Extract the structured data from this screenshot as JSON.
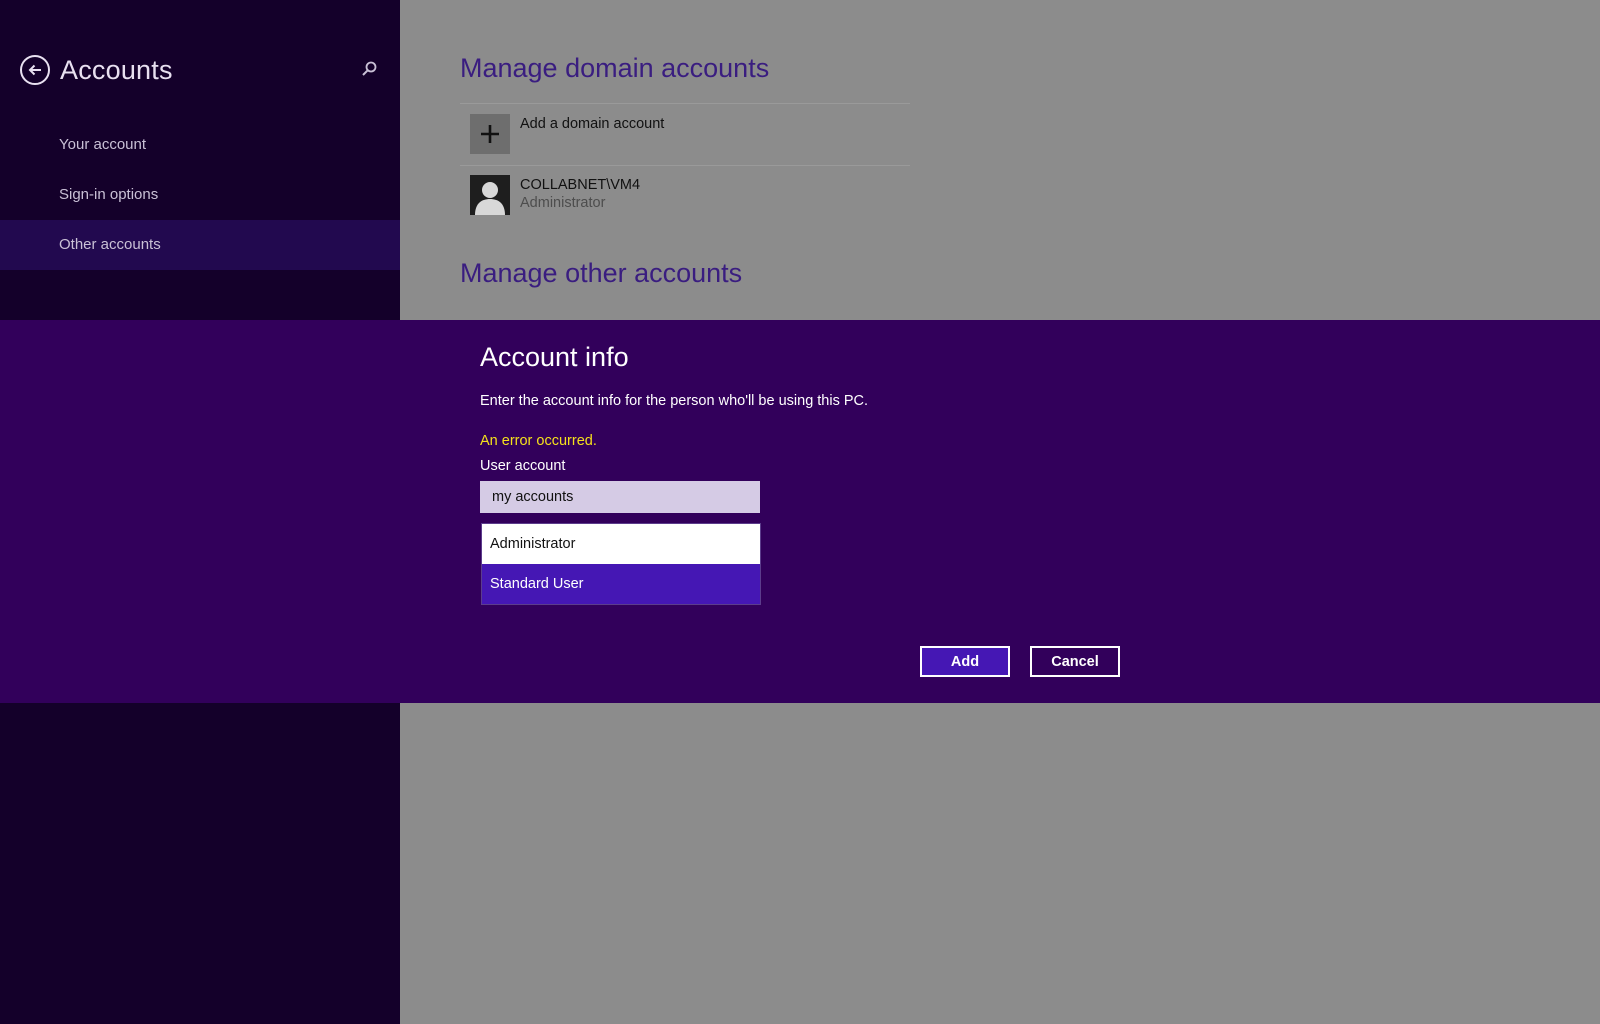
{
  "sidebar": {
    "title": "Accounts",
    "back_icon": "back-arrow-icon",
    "search_icon": "search-icon",
    "items": [
      {
        "label": "Your account"
      },
      {
        "label": "Sign-in options"
      },
      {
        "label": "Other accounts",
        "selected": true
      }
    ]
  },
  "main": {
    "domain_section_title": "Manage domain accounts",
    "add_domain": {
      "label": "Add a domain account",
      "icon": "plus-icon"
    },
    "domain_account": {
      "name": "COLLABNET\\VM4",
      "role": "Administrator",
      "icon": "user-icon"
    },
    "other_section_title": "Manage other accounts"
  },
  "dialog": {
    "title": "Account info",
    "description": "Enter the account info for the person who'll be using this PC.",
    "error": "An error occurred.",
    "user_account_label": "User account",
    "user_account_value": "my accounts",
    "account_type_options": [
      "Administrator",
      "Standard User"
    ],
    "highlighted_option": "Standard User",
    "add_label": "Add",
    "cancel_label": "Cancel"
  },
  "colors": {
    "sidebar_bg": "#14002a",
    "dialog_bg": "#32005b",
    "accent": "#4517b4",
    "error_text": "#f5e11c",
    "section_title": "#3a1d80"
  }
}
